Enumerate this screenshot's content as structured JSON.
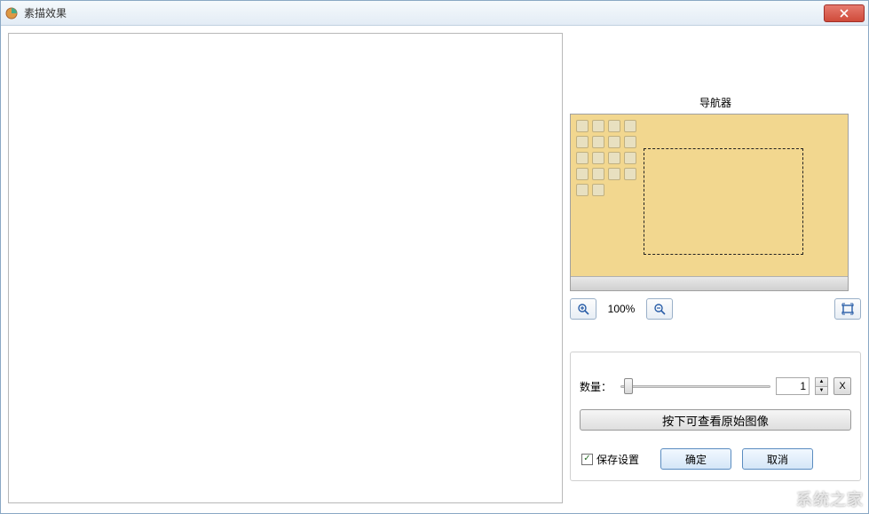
{
  "window": {
    "title": "素描效果"
  },
  "navigator": {
    "label": "导航器"
  },
  "zoom": {
    "percent": "100%"
  },
  "controls": {
    "amount_label": "数量：",
    "amount_value": "1",
    "x_btn": "X",
    "view_original": "按下可查看原始图像"
  },
  "footer": {
    "save_settings": "保存设置",
    "ok": "确定",
    "cancel": "取消"
  },
  "watermark": "系统之家"
}
